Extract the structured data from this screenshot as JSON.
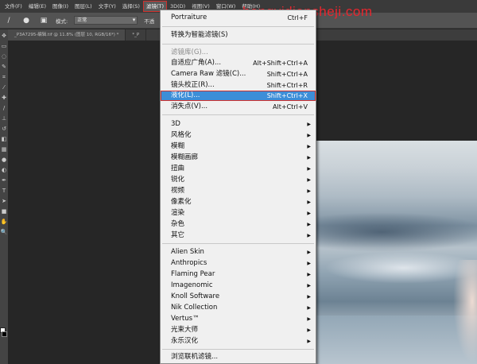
{
  "menubar": {
    "items": [
      {
        "label": "文件(F)"
      },
      {
        "label": "编辑(E)"
      },
      {
        "label": "图像(I)"
      },
      {
        "label": "图层(L)"
      },
      {
        "label": "文字(Y)"
      },
      {
        "label": "选择(S)"
      },
      {
        "label": "滤镜(T)",
        "active": true
      },
      {
        "label": "3D(D)"
      },
      {
        "label": "视图(V)"
      },
      {
        "label": "窗口(W)"
      },
      {
        "label": "帮助(H)"
      }
    ]
  },
  "options_bar": {
    "mode_label": "模式:",
    "mode_value": "正常",
    "opacity_label": "不透"
  },
  "tabs": [
    {
      "label": "_P3A7295-编辑.tif @ 11.8% (图层 10, RGB/16*) *"
    },
    {
      "label": "*_P"
    }
  ],
  "watermark": "hangyidiansheji.com",
  "filter_menu": {
    "items": [
      {
        "label": "Portraiture",
        "shortcut": "Ctrl+F"
      },
      {
        "label": "转换为智能滤镜(S)"
      },
      {
        "label": "滤镜库(G)...",
        "disabled": true
      },
      {
        "label": "自适应广角(A)...",
        "shortcut": "Alt+Shift+Ctrl+A"
      },
      {
        "label": "Camera Raw 滤镜(C)...",
        "shortcut": "Shift+Ctrl+A"
      },
      {
        "label": "镜头校正(R)...",
        "shortcut": "Shift+Ctrl+R"
      },
      {
        "label": "液化(L)...",
        "shortcut": "Shift+Ctrl+X",
        "highlighted": true
      },
      {
        "label": "消失点(V)...",
        "shortcut": "Alt+Ctrl+V"
      },
      {
        "label": "3D",
        "submenu": true
      },
      {
        "label": "风格化",
        "submenu": true
      },
      {
        "label": "模糊",
        "submenu": true
      },
      {
        "label": "模糊画廊",
        "submenu": true
      },
      {
        "label": "扭曲",
        "submenu": true
      },
      {
        "label": "锐化",
        "submenu": true
      },
      {
        "label": "视频",
        "submenu": true
      },
      {
        "label": "像素化",
        "submenu": true
      },
      {
        "label": "渲染",
        "submenu": true
      },
      {
        "label": "杂色",
        "submenu": true
      },
      {
        "label": "其它",
        "submenu": true
      },
      {
        "label": "Alien Skin",
        "submenu": true
      },
      {
        "label": "Anthropics",
        "submenu": true
      },
      {
        "label": "Flaming Pear",
        "submenu": true
      },
      {
        "label": "Imagenomic",
        "submenu": true
      },
      {
        "label": "Knoll Software",
        "submenu": true
      },
      {
        "label": "Nik Collection",
        "submenu": true
      },
      {
        "label": "Vertus™",
        "submenu": true
      },
      {
        "label": "光束大师",
        "submenu": true
      },
      {
        "label": "永乐汉化",
        "submenu": true
      },
      {
        "label": "浏览联机滤镜..."
      }
    ]
  },
  "colors": {
    "highlight": "#3c8ed8",
    "watermark": "#e8262e",
    "outline": "#d0312d"
  }
}
